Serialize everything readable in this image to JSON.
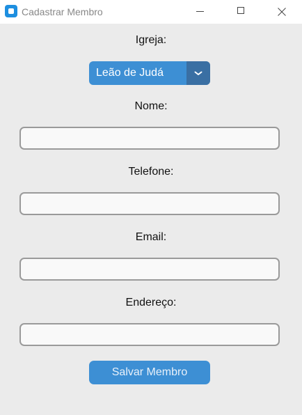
{
  "window": {
    "title": "Cadastrar Membro",
    "icon": "app-icon"
  },
  "form": {
    "igreja": {
      "label": "Igreja:",
      "selected": "Leão de Judá"
    },
    "nome": {
      "label": "Nome:",
      "value": "",
      "placeholder": ""
    },
    "telefone": {
      "label": "Telefone:",
      "value": "",
      "placeholder": ""
    },
    "email": {
      "label": "Email:",
      "value": "",
      "placeholder": ""
    },
    "endereco": {
      "label": "Endereço:",
      "value": "",
      "placeholder": ""
    },
    "save_label": "Salvar Membro"
  },
  "colors": {
    "accent": "#3d8fd4",
    "accent_dark": "#3a6fa3",
    "background": "#ebebeb",
    "field_border": "#9a9a9a"
  }
}
